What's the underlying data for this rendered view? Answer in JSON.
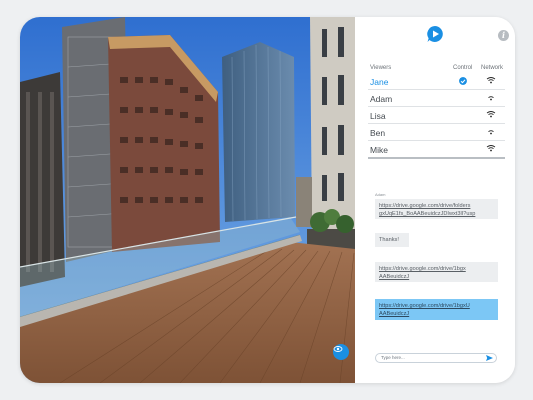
{
  "viewers_header": {
    "viewers": "Viewers",
    "control": "Control",
    "network": "Network"
  },
  "viewers": [
    {
      "name": "Jane",
      "has_control": true,
      "active": true
    },
    {
      "name": "Adam",
      "has_control": false,
      "active": false
    },
    {
      "name": "Lisa",
      "has_control": false,
      "active": false
    },
    {
      "name": "Ben",
      "has_control": false,
      "active": false
    },
    {
      "name": "Mike",
      "has_control": false,
      "active": false
    }
  ],
  "chat": [
    {
      "sender": "Adam",
      "text": "https://drive.google.com/drive/folders gxUqE1fs_BoAABeuidczJDIwxt3lI?usp"
    },
    {
      "sender": "",
      "text": "Thanks!"
    },
    {
      "sender": "",
      "text": "https://drive.google.com/drive/1bgx AABeuidczJ"
    },
    {
      "sender": "",
      "text": "https://drive.google.com/drive/1bgxU AABeuidczJ"
    }
  ],
  "chat_input": {
    "placeholder": "Type here..."
  },
  "colors": {
    "accent": "#1a8fe3",
    "my_bubble": "#7cc7f5",
    "other_bubble": "#eceef0"
  },
  "icons": {
    "logo": "play-logo-icon",
    "info": "info-icon",
    "control": "check-circle-icon",
    "network": "wifi-icon",
    "send": "send-icon",
    "eye": "eye-icon"
  }
}
